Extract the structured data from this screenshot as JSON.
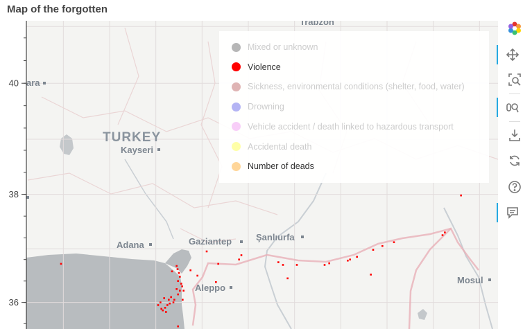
{
  "title": "Map of the forgotten",
  "map_labels": {
    "country": "TURKEY",
    "cities": [
      "Trabzon",
      "Kayseri",
      "Adana",
      "Gaziantep",
      "Şanlıurfa",
      "Aleppo",
      "Mosul"
    ]
  },
  "chart_data": {
    "type": "scatter",
    "title": "Map of the forgotten",
    "xlabel": "",
    "ylabel": "",
    "ylim": [
      35.5,
      41.1
    ],
    "xlim": [
      33.2,
      43.4
    ],
    "y_ticks": [
      "40",
      "38",
      "36"
    ],
    "grid": true,
    "legend_placement": "top-right",
    "legend": [
      {
        "label": "Mixed or unknown",
        "color": "#a9a9a9",
        "visible": false
      },
      {
        "label": "Violence",
        "color": "#ff0000",
        "visible": true
      },
      {
        "label": "Sickness, environmental conditions (shelter, food, water)",
        "color": "#d9a7a7",
        "visible": false
      },
      {
        "label": "Drowning",
        "color": "#a7a7f2",
        "visible": false
      },
      {
        "label": "Vehicle accident / death linked to hazardous transport",
        "color": "#f7c6f7",
        "visible": false
      },
      {
        "label": "Accidental death",
        "color": "#ffff99",
        "visible": false
      },
      {
        "label": "Number of deads",
        "color": "#ffd699",
        "visible": true
      }
    ],
    "series": [
      {
        "name": "Violence",
        "color": "#ff0000",
        "points": [
          [
            36.35,
            36.58
          ],
          [
            36.45,
            36.68
          ],
          [
            36.47,
            36.62
          ],
          [
            36.5,
            36.55
          ],
          [
            36.52,
            36.48
          ],
          [
            36.48,
            36.4
          ],
          [
            36.55,
            36.35
          ],
          [
            36.57,
            36.3
          ],
          [
            36.45,
            36.25
          ],
          [
            36.52,
            36.22
          ],
          [
            36.6,
            36.22
          ],
          [
            36.48,
            36.15
          ],
          [
            36.4,
            36.05
          ],
          [
            36.38,
            36.0
          ],
          [
            36.3,
            35.98
          ],
          [
            36.25,
            35.95
          ],
          [
            36.2,
            35.9
          ],
          [
            36.15,
            35.85
          ],
          [
            36.22,
            35.82
          ],
          [
            36.18,
            36.08
          ],
          [
            36.1,
            36.0
          ],
          [
            36.05,
            35.95
          ],
          [
            36.12,
            35.88
          ],
          [
            36.28,
            36.05
          ],
          [
            36.33,
            36.1
          ],
          [
            36.9,
            36.5
          ],
          [
            36.75,
            36.6
          ],
          [
            37.3,
            36.38
          ],
          [
            37.1,
            36.95
          ],
          [
            37.35,
            36.72
          ],
          [
            37.8,
            36.8
          ],
          [
            37.85,
            36.88
          ],
          [
            38.65,
            36.75
          ],
          [
            38.75,
            36.7
          ],
          [
            39.05,
            36.7
          ],
          [
            39.65,
            36.7
          ],
          [
            39.75,
            36.73
          ],
          [
            40.15,
            36.78
          ],
          [
            40.2,
            36.8
          ],
          [
            40.35,
            36.85
          ],
          [
            40.7,
            36.98
          ],
          [
            40.9,
            37.05
          ],
          [
            41.15,
            37.12
          ],
          [
            42.2,
            37.25
          ],
          [
            42.25,
            37.3
          ],
          [
            42.6,
            37.98
          ],
          [
            40.65,
            36.52
          ],
          [
            38.85,
            36.45
          ],
          [
            33.95,
            36.72
          ],
          [
            36.48,
            35.55
          ],
          [
            36.58,
            36.05
          ]
        ]
      }
    ]
  },
  "toolbar": {
    "logo": "bokeh-logo-icon",
    "tools": [
      "pan-icon",
      "box-zoom-icon",
      "wheel-zoom-icon",
      "save-icon",
      "reset-icon",
      "help-icon",
      "hover-icon"
    ]
  }
}
